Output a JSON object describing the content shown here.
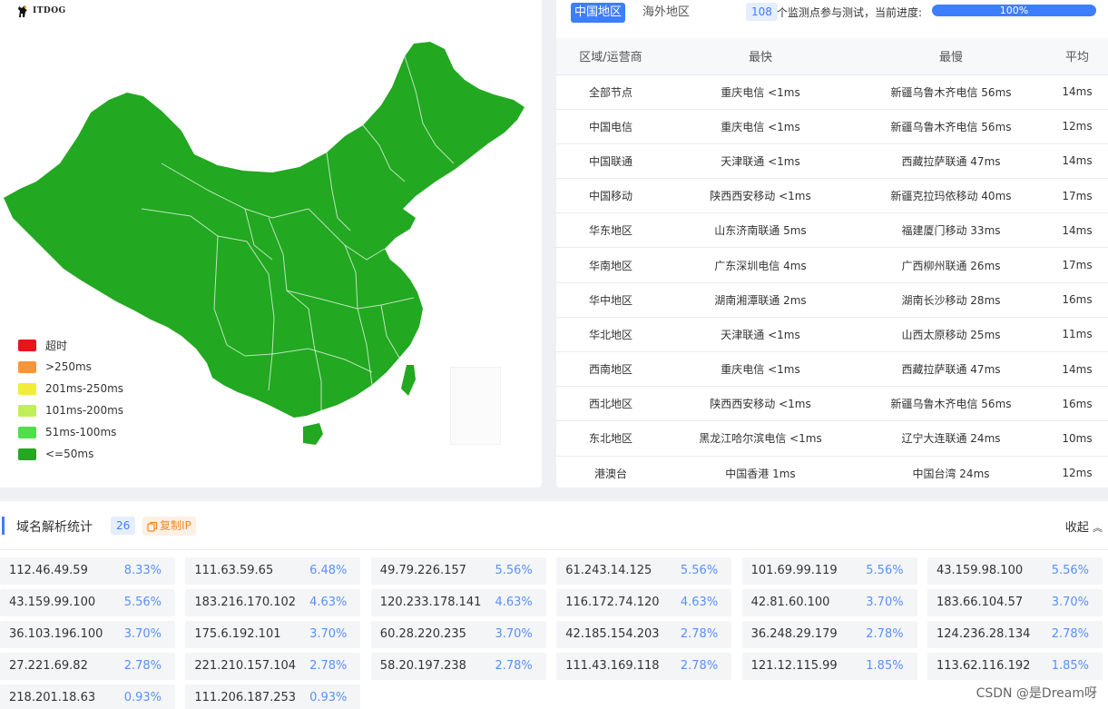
{
  "logo": {
    "text": "ITDOG"
  },
  "legend": [
    {
      "label": "超时",
      "color": "#e8141c"
    },
    {
      "label": ">250ms",
      "color": "#f7953b"
    },
    {
      "label": "201ms-250ms",
      "color": "#f3eb3a"
    },
    {
      "label": "101ms-200ms",
      "color": "#c2ef58"
    },
    {
      "label": "51ms-100ms",
      "color": "#4de04b"
    },
    {
      "label": "<=50ms",
      "color": "#22a821"
    }
  ],
  "map": {
    "fill": "#22a821"
  },
  "tabs": {
    "active": "中国地区",
    "other": "海外地区"
  },
  "monitor": {
    "count": "108",
    "text": "个监测点参与测试，当前进度:",
    "progress_label": "100%",
    "progress": 1.0
  },
  "table": {
    "headers": [
      "区域/运营商",
      "最快",
      "最慢",
      "平均"
    ],
    "rows": [
      [
        "全部节点",
        "重庆电信 <1ms",
        "新疆乌鲁木齐电信 56ms",
        "14ms"
      ],
      [
        "中国电信",
        "重庆电信 <1ms",
        "新疆乌鲁木齐电信 56ms",
        "12ms"
      ],
      [
        "中国联通",
        "天津联通 <1ms",
        "西藏拉萨联通 47ms",
        "14ms"
      ],
      [
        "中国移动",
        "陕西西安移动 <1ms",
        "新疆克拉玛依移动 40ms",
        "17ms"
      ],
      [
        "华东地区",
        "山东济南联通 5ms",
        "福建厦门移动 33ms",
        "14ms"
      ],
      [
        "华南地区",
        "广东深圳电信 4ms",
        "广西柳州联通 26ms",
        "17ms"
      ],
      [
        "华中地区",
        "湖南湘潭联通 2ms",
        "湖南长沙移动 28ms",
        "16ms"
      ],
      [
        "华北地区",
        "天津联通 <1ms",
        "山西太原移动 25ms",
        "11ms"
      ],
      [
        "西南地区",
        "重庆电信 <1ms",
        "西藏拉萨联通 47ms",
        "14ms"
      ],
      [
        "西北地区",
        "陕西西安移动 <1ms",
        "新疆乌鲁木齐电信 56ms",
        "16ms"
      ],
      [
        "东北地区",
        "黑龙江哈尔滨电信 <1ms",
        "辽宁大连联通 24ms",
        "10ms"
      ],
      [
        "港澳台",
        "中国香港 1ms",
        "中国台湾 24ms",
        "12ms"
      ]
    ]
  },
  "dns": {
    "title": "域名解析统计",
    "count": "26",
    "copy_label": "复制IP",
    "collapse_label": "收起",
    "ips": [
      [
        "112.46.49.59",
        "8.33%"
      ],
      [
        "111.63.59.65",
        "6.48%"
      ],
      [
        "49.79.226.157",
        "5.56%"
      ],
      [
        "61.243.14.125",
        "5.56%"
      ],
      [
        "101.69.99.119",
        "5.56%"
      ],
      [
        "43.159.98.100",
        "5.56%"
      ],
      [
        "43.159.99.100",
        "5.56%"
      ],
      [
        "183.216.170.102",
        "4.63%"
      ],
      [
        "120.233.178.141",
        "4.63%"
      ],
      [
        "116.172.74.120",
        "4.63%"
      ],
      [
        "42.81.60.100",
        "3.70%"
      ],
      [
        "183.66.104.57",
        "3.70%"
      ],
      [
        "36.103.196.100",
        "3.70%"
      ],
      [
        "175.6.192.101",
        "3.70%"
      ],
      [
        "60.28.220.235",
        "3.70%"
      ],
      [
        "42.185.154.203",
        "2.78%"
      ],
      [
        "36.248.29.179",
        "2.78%"
      ],
      [
        "124.236.28.134",
        "2.78%"
      ],
      [
        "27.221.69.82",
        "2.78%"
      ],
      [
        "221.210.157.104",
        "2.78%"
      ],
      [
        "58.20.197.238",
        "2.78%"
      ],
      [
        "111.43.169.118",
        "2.78%"
      ],
      [
        "121.12.115.99",
        "1.85%"
      ],
      [
        "113.62.116.192",
        "1.85%"
      ],
      [
        "218.201.18.63",
        "0.93%"
      ],
      [
        "111.206.187.253",
        "0.93%"
      ]
    ]
  },
  "watermark": "CSDN @是Dream呀"
}
